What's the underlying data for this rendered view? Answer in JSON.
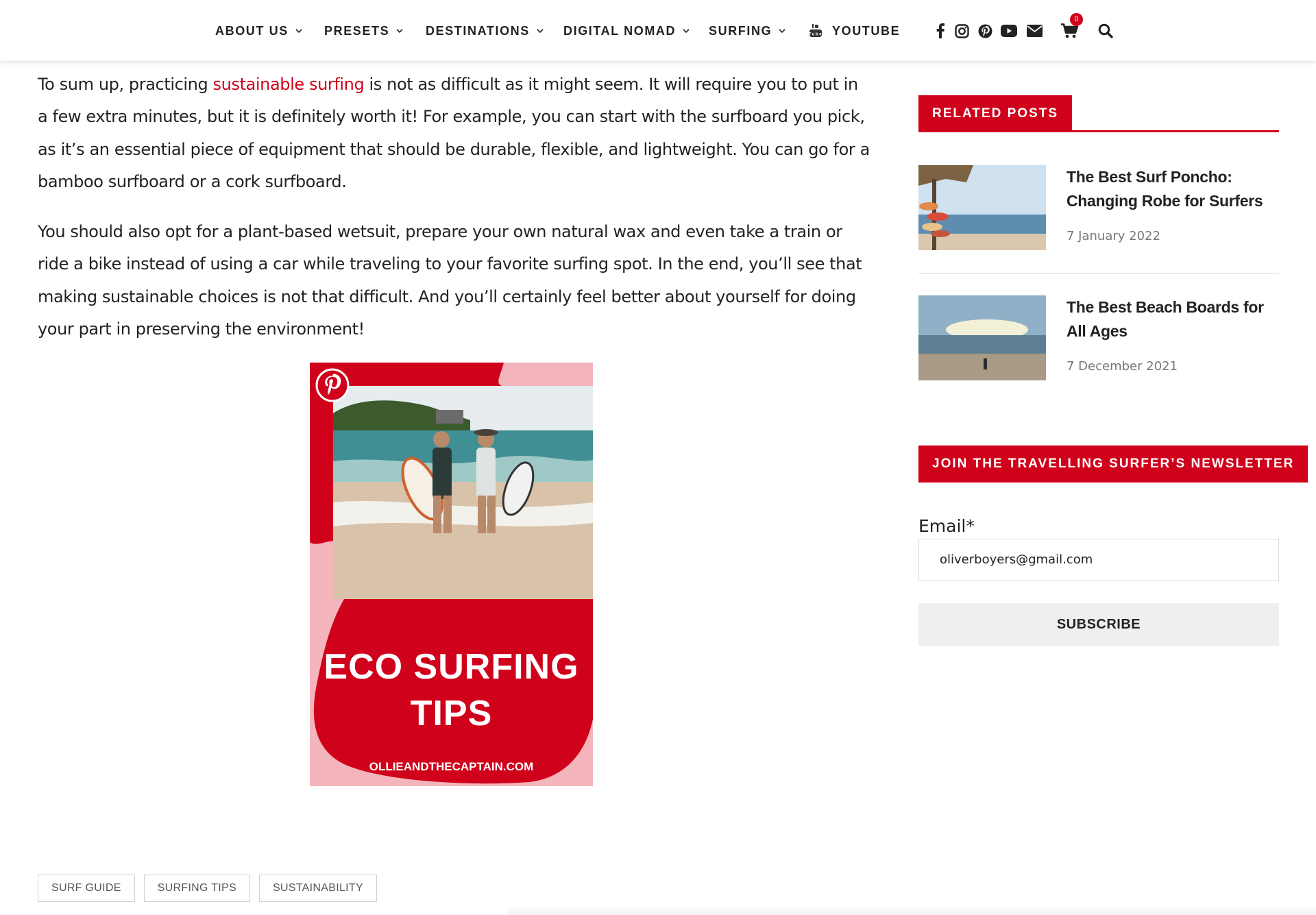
{
  "nav": {
    "items": [
      {
        "label": "ABOUT US",
        "has_dropdown": true
      },
      {
        "label": "PRESETS",
        "has_dropdown": true
      },
      {
        "label": "DESTINATIONS",
        "has_dropdown": true
      },
      {
        "label": "DIGITAL NOMAD",
        "has_dropdown": true
      },
      {
        "label": "SURFING",
        "has_dropdown": true
      },
      {
        "label": "YOUTUBE",
        "has_dropdown": false,
        "icon": "youtube-small-icon"
      }
    ],
    "social_icons": [
      "facebook-icon",
      "instagram-icon",
      "pinterest-icon",
      "youtube-icon",
      "envelope-icon"
    ],
    "cart_count": "0",
    "search_icon": "search-icon"
  },
  "article": {
    "p1": {
      "before": "To sum up, practicing ",
      "link": "sustainable surfing",
      "after": " is not as difficult as it might seem. It will require you to put in a few extra minutes, but it is definitely worth it! For example, you can start with the surfboard you pick, as it’s an essential piece of equipment that should be durable, flexible, and lightweight. You can go for a bamboo surfboard or a cork surfboard."
    },
    "p2": "You should also opt for a plant-based wetsuit, prepare your own natural wax and even take a train or ride a bike instead of using a car while traveling to your favorite surfing spot. In the end, you’ll see that making sustainable choices is not that difficult. And you’ll certainly feel better about yourself for doing your part in preserving the environment!",
    "pin_image": {
      "title_line1": "ECO SURFING",
      "title_line2": "TIPS",
      "url": "OLLIEANDTHECAPTAIN.COM"
    },
    "tags": [
      "SURF GUIDE",
      "SURFING TIPS",
      "SUSTAINABILITY"
    ]
  },
  "sidebar": {
    "related_heading": "RELATED POSTS",
    "posts": [
      {
        "title": "The Best Surf Poncho: Changing Robe for Surfers",
        "date": "7 January 2022"
      },
      {
        "title": "The Best Beach Boards for All Ages",
        "date": "7 December 2021"
      }
    ],
    "newsletter_heading": "JOIN THE TRAVELLING SURFER’S NEWSLETTER",
    "email_label": "Email*",
    "email_value": "oliverboyers@gmail.com",
    "subscribe_label": "SUBSCRIBE"
  },
  "colors": {
    "accent": "#d0021b",
    "pin_pink": "#f4b4bb"
  }
}
